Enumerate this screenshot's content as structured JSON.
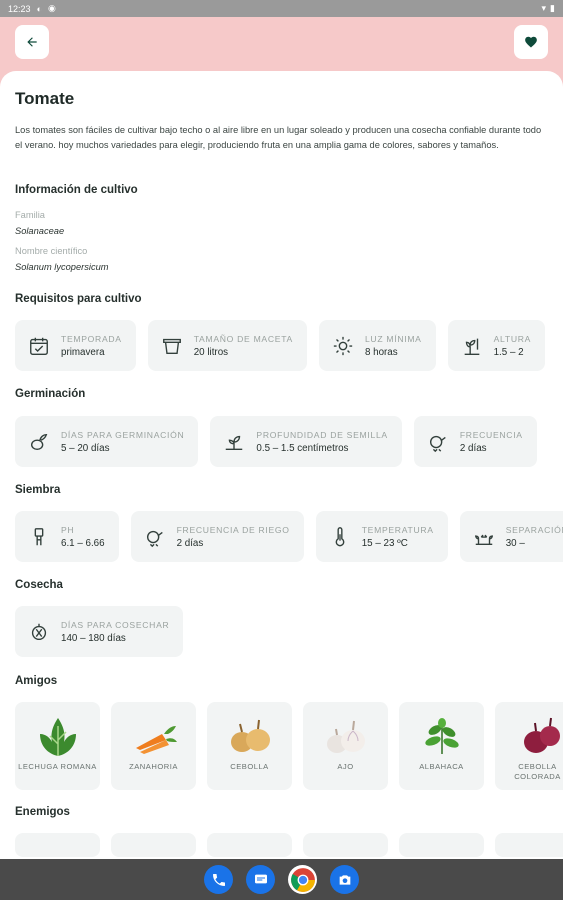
{
  "status_bar": {
    "time": "12:23"
  },
  "header": {
    "back_icon": "arrow-left-icon",
    "favorite_icon": "heart-icon",
    "bg": "#f6c9c9",
    "accent": "#0e4a3a"
  },
  "plant": {
    "name": "Tomate",
    "description": "Los tomates son fáciles de cultivar bajo techo o al aire libre en un lugar soleado y producen una cosecha confiable durante todo el verano. hoy muchos variedades para elegir, produciendo fruta en una amplia gama de colores, sabores y tamaños."
  },
  "sections": {
    "info": "Información de cultivo",
    "requirements": "Requisitos para cultivo",
    "germination": "Germinación",
    "sowing": "Siembra",
    "harvest": "Cosecha",
    "friends": "Amigos",
    "enemies": "Enemigos"
  },
  "info": {
    "family_label": "Familia",
    "family_value": "Solanaceae",
    "scientific_label": "Nombre científico",
    "scientific_value": "Solanum lycopersicum"
  },
  "requirements": [
    {
      "icon": "calendar-icon",
      "label": "Temporada",
      "value": "primavera"
    },
    {
      "icon": "pot-icon",
      "label": "Tamaño de maceta",
      "value": "20 litros"
    },
    {
      "icon": "sun-icon",
      "label": "Luz mínima",
      "value": "8 horas"
    },
    {
      "icon": "height-icon",
      "label": "Altura",
      "value": "1.5 – 2"
    }
  ],
  "germination": [
    {
      "icon": "seed-icon",
      "label": "Días para germinación",
      "value": "5 – 20 días"
    },
    {
      "icon": "seed-depth-icon",
      "label": "Profundidad de semilla",
      "value": "0.5 – 1.5 centímetros"
    },
    {
      "icon": "watering-icon",
      "label": "Frecuencia",
      "value": "2 días"
    }
  ],
  "sowing": [
    {
      "icon": "ph-icon",
      "label": "PH",
      "value": "6.1 – 6.66"
    },
    {
      "icon": "watering-icon",
      "label": "Frecuencia de riego",
      "value": "2 días"
    },
    {
      "icon": "thermometer-icon",
      "label": "Temperatura",
      "value": "15 – 23 ºC"
    },
    {
      "icon": "spacing-icon",
      "label": "Separación",
      "value": "30 –"
    }
  ],
  "harvest": [
    {
      "icon": "basket-icon",
      "label": "Días para cosechar",
      "value": "140 – 180 días"
    }
  ],
  "friends": [
    {
      "name": "Lechuga romana",
      "icon": "lettuce-icon"
    },
    {
      "name": "Zanahoria",
      "icon": "carrot-icon"
    },
    {
      "name": "Cebolla",
      "icon": "onion-icon"
    },
    {
      "name": "Ajo",
      "icon": "garlic-icon"
    },
    {
      "name": "Albahaca",
      "icon": "basil-icon"
    },
    {
      "name": "Cebolla colorada",
      "icon": "red-onion-icon"
    }
  ],
  "nav_bar": [
    {
      "icon": "phone-icon",
      "color": "#1a73e8"
    },
    {
      "icon": "messages-icon",
      "color": "#1a73e8"
    },
    {
      "icon": "chrome-icon",
      "color": "#ffffff"
    },
    {
      "icon": "camera-icon",
      "color": "#1a73e8"
    }
  ]
}
